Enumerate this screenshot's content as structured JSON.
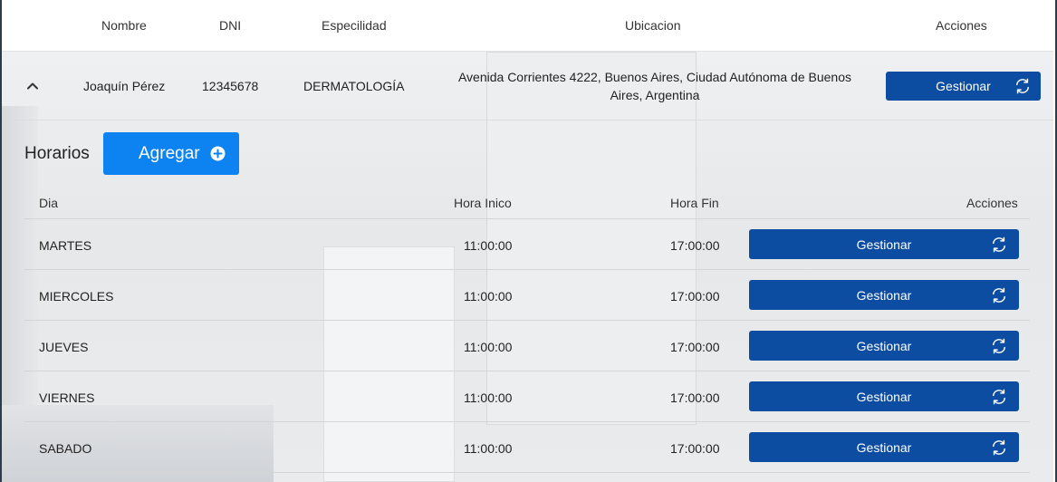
{
  "header": {
    "columns": [
      "Nombre",
      "DNI",
      "Especilidad",
      "Ubicacion",
      "Acciones"
    ]
  },
  "patient": {
    "nombre": "Joaquín Pérez",
    "dni": "12345678",
    "especialidad": "DERMATOLOGÍA",
    "ubicacion": "Avenida Corrientes 4222, Buenos Aires, Ciudad Autónoma de Buenos Aires, Argentina",
    "action_label": "Gestionar"
  },
  "horarios": {
    "title": "Horarios",
    "add_label": "Agregar",
    "columns": [
      "Dia",
      "Hora Inico",
      "Hora Fin",
      "Acciones"
    ],
    "rows": [
      {
        "dia": "MARTES",
        "inicio": "11:00:00",
        "fin": "17:00:00",
        "action": "Gestionar"
      },
      {
        "dia": "MIERCOLES",
        "inicio": "11:00:00",
        "fin": "17:00:00",
        "action": "Gestionar"
      },
      {
        "dia": "JUEVES",
        "inicio": "11:00:00",
        "fin": "17:00:00",
        "action": "Gestionar"
      },
      {
        "dia": "VIERNES",
        "inicio": "11:00:00",
        "fin": "17:00:00",
        "action": "Gestionar"
      },
      {
        "dia": "SABADO",
        "inicio": "11:00:00",
        "fin": "17:00:00",
        "action": "Gestionar"
      }
    ]
  },
  "colors": {
    "primary_button": "#0c4da2",
    "add_button": "#0d83f2"
  },
  "icons": {
    "expand": "chevron-up-icon",
    "manage": "sync-icon",
    "add": "plus-circle-icon"
  }
}
